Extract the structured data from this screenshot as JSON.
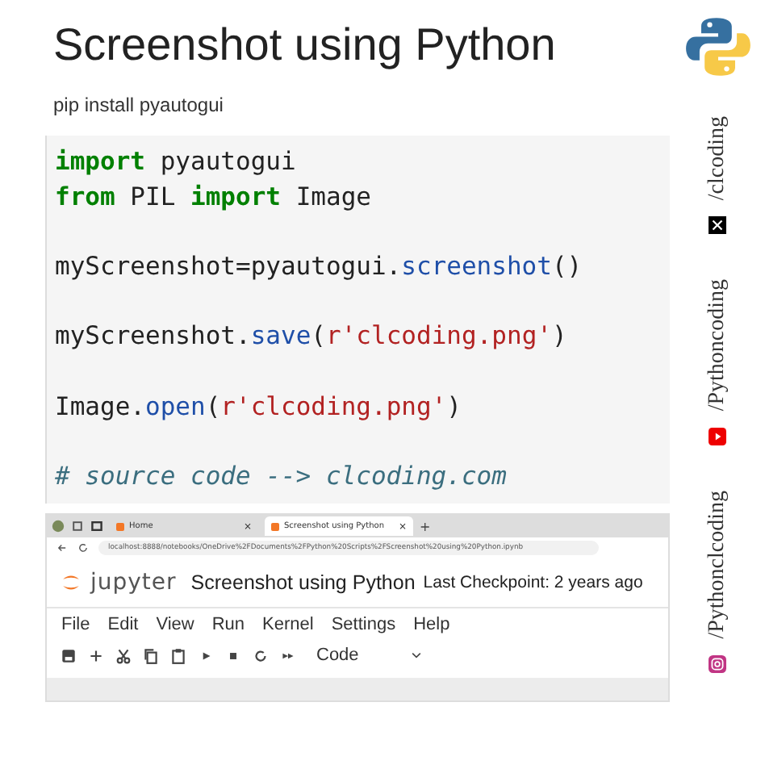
{
  "title": "Screenshot using Python",
  "subtitle": "pip install pyautogui",
  "code_lines": [
    {
      "kind": "code",
      "tokens": [
        {
          "text": "import",
          "kind": "keyword"
        },
        {
          "text": " pyautogui",
          "kind": "plain"
        }
      ]
    },
    {
      "kind": "code",
      "tokens": [
        {
          "text": "from",
          "kind": "keyword"
        },
        {
          "text": " PIL ",
          "kind": "plain"
        },
        {
          "text": "import",
          "kind": "keyword"
        },
        {
          "text": " Image",
          "kind": "plain"
        }
      ]
    },
    {
      "kind": "blank"
    },
    {
      "kind": "code",
      "tokens": [
        {
          "text": "myScreenshot=pyautogui.",
          "kind": "plain"
        },
        {
          "text": "screenshot",
          "kind": "call"
        },
        {
          "text": "()",
          "kind": "plain"
        }
      ]
    },
    {
      "kind": "blank"
    },
    {
      "kind": "code",
      "tokens": [
        {
          "text": "myScreenshot.",
          "kind": "plain"
        },
        {
          "text": "save",
          "kind": "call"
        },
        {
          "text": "(",
          "kind": "plain"
        },
        {
          "text": "r'clcoding.png'",
          "kind": "string"
        },
        {
          "text": ")",
          "kind": "plain"
        }
      ]
    },
    {
      "kind": "blank"
    },
    {
      "kind": "code",
      "tokens": [
        {
          "text": "Image.",
          "kind": "plain"
        },
        {
          "text": "open",
          "kind": "call"
        },
        {
          "text": "(",
          "kind": "plain"
        },
        {
          "text": "r'clcoding.png'",
          "kind": "string"
        },
        {
          "text": ")",
          "kind": "plain"
        }
      ]
    },
    {
      "kind": "blank"
    },
    {
      "kind": "code",
      "tokens": [
        {
          "text": "# source code --> clcoding.com",
          "kind": "comment"
        }
      ]
    }
  ],
  "browser": {
    "tabs": [
      {
        "label": "Home",
        "selected": false,
        "close": "×"
      },
      {
        "label": "Screenshot using Python",
        "selected": true,
        "close": "×"
      }
    ],
    "new_tab": "+",
    "url": "localhost:8888/notebooks/OneDrive%2FDocuments%2FPython%20Scripts%2FScreenshot%20using%20Python.ipynb",
    "jupyter": {
      "logo_text": "jupyter",
      "notebook": "Screenshot using Python",
      "checkpoint": "Last Checkpoint: 2 years ago",
      "menu": [
        "File",
        "Edit",
        "View",
        "Run",
        "Kernel",
        "Settings",
        "Help"
      ],
      "toolbar": [
        {
          "kind": "save"
        },
        {
          "kind": "add"
        },
        {
          "kind": "cut"
        },
        {
          "kind": "copy"
        },
        {
          "kind": "paste"
        },
        {
          "kind": "run"
        },
        {
          "kind": "stop"
        },
        {
          "kind": "restart"
        },
        {
          "kind": "fastforward"
        }
      ],
      "cell_type": "Code"
    }
  },
  "socials": [
    {
      "kind": "x",
      "handle": "/clcoding"
    },
    {
      "kind": "youtube",
      "handle": "/Pythoncoding"
    },
    {
      "kind": "instagram",
      "handle": "/Pythonclcoding"
    }
  ]
}
